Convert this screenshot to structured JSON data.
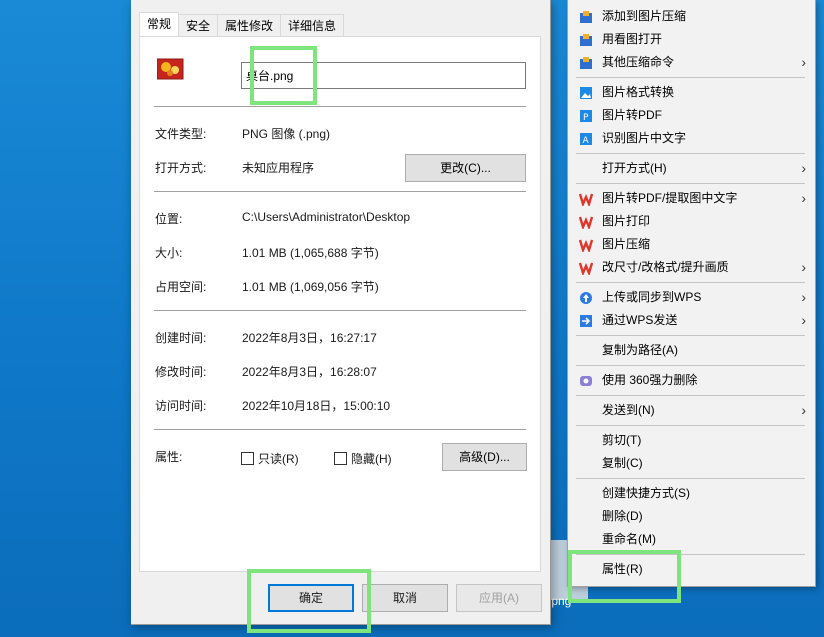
{
  "dialog": {
    "tabs": [
      "常规",
      "安全",
      "属性修改",
      "详细信息"
    ],
    "filename": "桌台.png",
    "file_type_label": "文件类型:",
    "file_type_value": "PNG 图像 (.png)",
    "open_with_label": "打开方式:",
    "open_with_value": "未知应用程序",
    "change_button": "更改(C)...",
    "location_label": "位置:",
    "location_value": "C:\\Users\\Administrator\\Desktop",
    "size_label": "大小:",
    "size_value": "1.01 MB (1,065,688 字节)",
    "disk_size_label": "占用空间:",
    "disk_size_value": "1.01 MB (1,069,056 字节)",
    "created_label": "创建时间:",
    "created_value": "2022年8月3日，16:27:17",
    "modified_label": "修改时间:",
    "modified_value": "2022年8月3日，16:28:07",
    "accessed_label": "访问时间:",
    "accessed_value": "2022年10月18日，15:00:10",
    "attributes_label": "属性:",
    "readonly_label": "只读(R)",
    "hidden_label": "隐藏(H)",
    "advanced_button": "高级(D)...",
    "ok_button": "确定",
    "cancel_button": "取消",
    "apply_button": "应用(A)"
  },
  "context_menu": {
    "items": [
      {
        "label": "添加到图片压缩",
        "icon": "compress-icon"
      },
      {
        "label": "用看图打开",
        "icon": "viewer-icon"
      },
      {
        "label": "其他压缩命令",
        "icon": "compress-icon",
        "submenu": true
      },
      {
        "label": "图片格式转换",
        "icon": "image-icon"
      },
      {
        "label": "图片转PDF",
        "icon": "pdf-icon"
      },
      {
        "label": "识别图片中文字",
        "icon": "ocr-icon"
      },
      {
        "label": "打开方式(H)",
        "submenu": true
      },
      {
        "label": "图片转PDF/提取图中文字",
        "icon": "wps-icon",
        "submenu": true
      },
      {
        "label": "图片打印",
        "icon": "wps-icon"
      },
      {
        "label": "图片压缩",
        "icon": "wps-icon"
      },
      {
        "label": "改尺寸/改格式/提升画质",
        "icon": "wps-icon",
        "submenu": true
      },
      {
        "label": "上传或同步到WPS",
        "icon": "cloud-upload-icon",
        "submenu": true
      },
      {
        "label": "通过WPS发送",
        "icon": "send-icon",
        "submenu": true
      },
      {
        "label": "复制为路径(A)"
      },
      {
        "label": "使用 360强力删除",
        "icon": "360-icon"
      },
      {
        "label": "发送到(N)",
        "submenu": true
      },
      {
        "label": "剪切(T)"
      },
      {
        "label": "复制(C)"
      },
      {
        "label": "创建快捷方式(S)"
      },
      {
        "label": "删除(D)"
      },
      {
        "label": "重命名(M)"
      },
      {
        "label": "属性(R)"
      }
    ]
  },
  "desktop": {
    "file_label": ".png"
  },
  "colors": {
    "highlight": "#7ee57c",
    "wps_red": "#e0362c",
    "accent": "#0078d7"
  }
}
